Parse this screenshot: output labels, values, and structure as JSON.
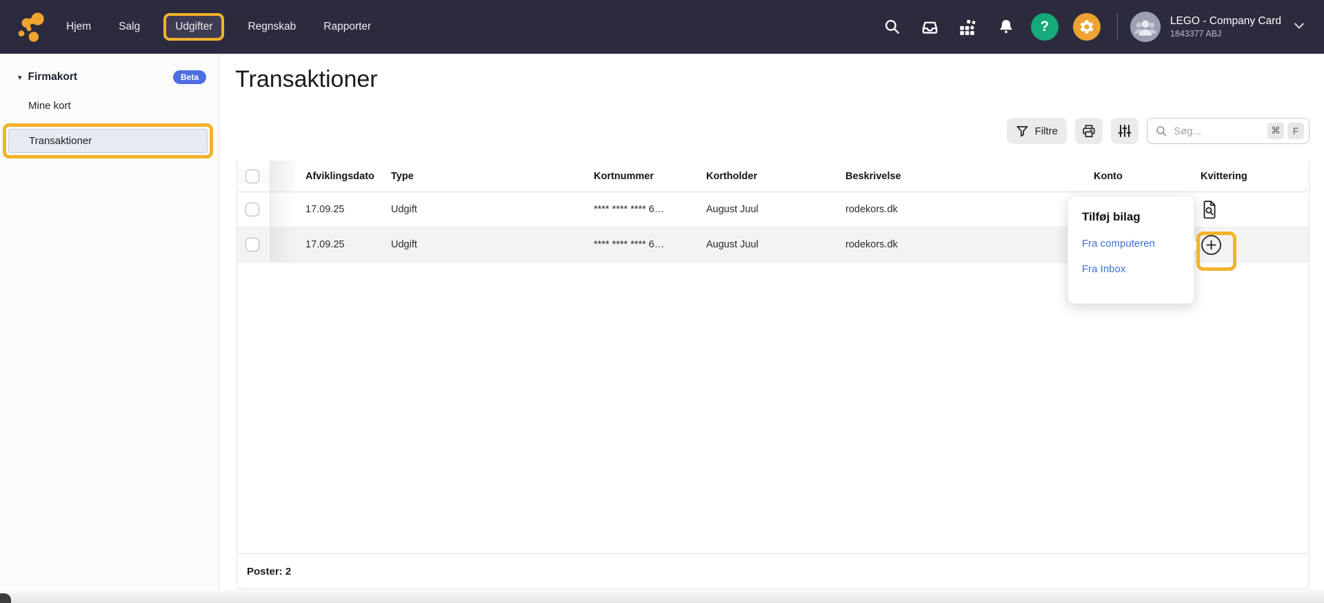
{
  "navbar": {
    "items": [
      {
        "label": "Hjem"
      },
      {
        "label": "Salg"
      },
      {
        "label": "Udgifter",
        "active": true,
        "annotated": true
      },
      {
        "label": "Regnskab"
      },
      {
        "label": "Rapporter"
      }
    ],
    "icons": [
      "search",
      "inbox",
      "apps",
      "notifications",
      "help",
      "settings"
    ],
    "help_glyph": "?",
    "account": {
      "name": "LEGO - Company Card",
      "id": "1843377 ABJ"
    }
  },
  "sidebar": {
    "section": {
      "label": "Firmakort",
      "badge": "Beta",
      "caret": "▾"
    },
    "items": [
      {
        "label": "Mine kort"
      },
      {
        "label": "Transaktioner",
        "selected": true,
        "annotated": true
      }
    ]
  },
  "main": {
    "title": "Transaktioner",
    "toolbar": {
      "filter_label": "Filtre",
      "search_placeholder": "Søg...",
      "shortcut_mod": "⌘",
      "shortcut_key": "F"
    },
    "table": {
      "columns": [
        "Afviklingsdato",
        "Type",
        "Kortnummer",
        "Kortholder",
        "Beskrivelse",
        "Konto",
        "Kvittering"
      ],
      "rows": [
        {
          "date": "17.09.25",
          "type": "Udgift",
          "card": "**** **** **** 6…",
          "holder": "August Juul",
          "desc": "rodekors.dk",
          "konto": "",
          "receipt_icon": "receipt-preview-icon"
        },
        {
          "date": "17.09.25",
          "type": "Udgift",
          "card": "**** **** **** 6…",
          "holder": "August Juul",
          "desc": "rodekors.dk",
          "konto": "",
          "receipt_icon": "add-receipt-icon"
        }
      ],
      "footer": "Poster: 2"
    },
    "popup": {
      "title": "Tilføj bilag",
      "links": [
        "Fra computeren",
        "Fra Inbox"
      ]
    }
  },
  "colors": {
    "navbar_bg": "#2C2B3D",
    "annotation_orange": "#F2B32B",
    "brand_orange": "#EFA42F",
    "help_green": "#16A97A",
    "settings_orange": "#EEA234",
    "beta_badge_blue": "#4D6EE4",
    "link_blue": "#3D6FD7",
    "selected_item_bg": "#E5EAF4"
  }
}
